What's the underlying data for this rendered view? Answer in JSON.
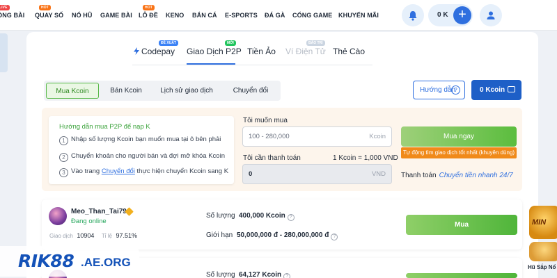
{
  "nav": {
    "items": [
      {
        "label": "SÒNG BÀI",
        "badge": "LIVE"
      },
      {
        "label": "QUAY SỐ",
        "badge": "HOT"
      },
      {
        "label": "NỔ HŨ",
        "badge": ""
      },
      {
        "label": "GAME BÀI",
        "badge": ""
      },
      {
        "label": "LÔ ĐỀ",
        "badge": "HOT"
      },
      {
        "label": "KENO",
        "badge": ""
      },
      {
        "label": "BẮN CÁ",
        "badge": ""
      },
      {
        "label": "E-SPORTS",
        "badge": ""
      },
      {
        "label": "ĐÁ GÀ",
        "badge": ""
      },
      {
        "label": "CỔNG GAME",
        "badge": ""
      },
      {
        "label": "KHUYẾN MÃI",
        "badge": ""
      }
    ],
    "balance": "0 K",
    "plus_symbol": "+"
  },
  "tabs": [
    {
      "label": "Codepay",
      "tag": "ĐỀ XUẤT",
      "state": "normal"
    },
    {
      "label": "Giao Dịch P2P",
      "tag": "MỚI",
      "state": "active"
    },
    {
      "label": "Tiền Ảo",
      "tag": "",
      "state": "normal"
    },
    {
      "label": "Ví Điện Tử",
      "tag": "BẢO TRÌ",
      "state": "disabled"
    },
    {
      "label": "Thẻ Cào",
      "tag": "",
      "state": "normal"
    }
  ],
  "subtabs": [
    {
      "label": "Mua Kcoin",
      "active": true
    },
    {
      "label": "Bán Kcoin",
      "active": false
    },
    {
      "label": "Lịch sử giao dịch",
      "active": false
    },
    {
      "label": "Chuyển đổi",
      "active": false
    }
  ],
  "actions": {
    "guide_label": "Hướng dẫn",
    "guide_icon_symbol": "?",
    "kcoin_label": "0 Kcoin"
  },
  "guide": {
    "title": "Hướng dẫn mua P2P để nạp K",
    "steps": [
      {
        "num": "1",
        "text": "Nhập số lượng Kcoin bạn muốn mua tại ô bên phải"
      },
      {
        "num": "2",
        "text": "Chuyển khoản cho người bán và đợi mở khóa Kcoin"
      },
      {
        "num": "3",
        "text_before": "Vào trang ",
        "link": "Chuyển đổi",
        "text_after": " thực hiện chuyển Kcoin sang K"
      }
    ]
  },
  "buy_form": {
    "want_label": "Tôi muốn mua",
    "want_placeholder": "100 - 280,000",
    "want_suffix": "Kcoin",
    "pay_label": "Tôi cần thanh toán",
    "rate": "1 Kcoin = 1,000 VND",
    "pay_value": "0",
    "pay_suffix": "VND",
    "buy_now_label": "Mua ngay",
    "auto_note": "Tự động tìm giao dịch tốt nhất (khuyên dùng)",
    "payment_label": "Thanh toán",
    "payment_method": "Chuyển tiền nhanh 24/7"
  },
  "sellers": [
    {
      "name": "Meo_Than_Tai79",
      "status": "Đang online",
      "trades_label": "Giao dịch",
      "trades": "10904",
      "rate_label": "Tỉ lệ",
      "rate": "97.51%",
      "qty_label": "Số lượng",
      "qty": "400,000 Kcoin",
      "limit_label": "Giới hạn",
      "limit": "50,000,000 đ - 280,000,000 đ",
      "buy_label": "Mua"
    },
    {
      "name": "",
      "status": "",
      "qty_label": "Số lượng",
      "qty": "64,127 Kcoin",
      "buy_label": ""
    }
  ],
  "info_symbol": "?",
  "watermark": {
    "brand": "RIK88",
    "domain": ".AE.ORG"
  },
  "promo": {
    "logo_text": "MIN",
    "caption": "Hũ Sắp Nổ"
  },
  "colors": {
    "primary": "#2f6fdf",
    "green": "#4fb53a",
    "orange": "#f08a1a"
  }
}
